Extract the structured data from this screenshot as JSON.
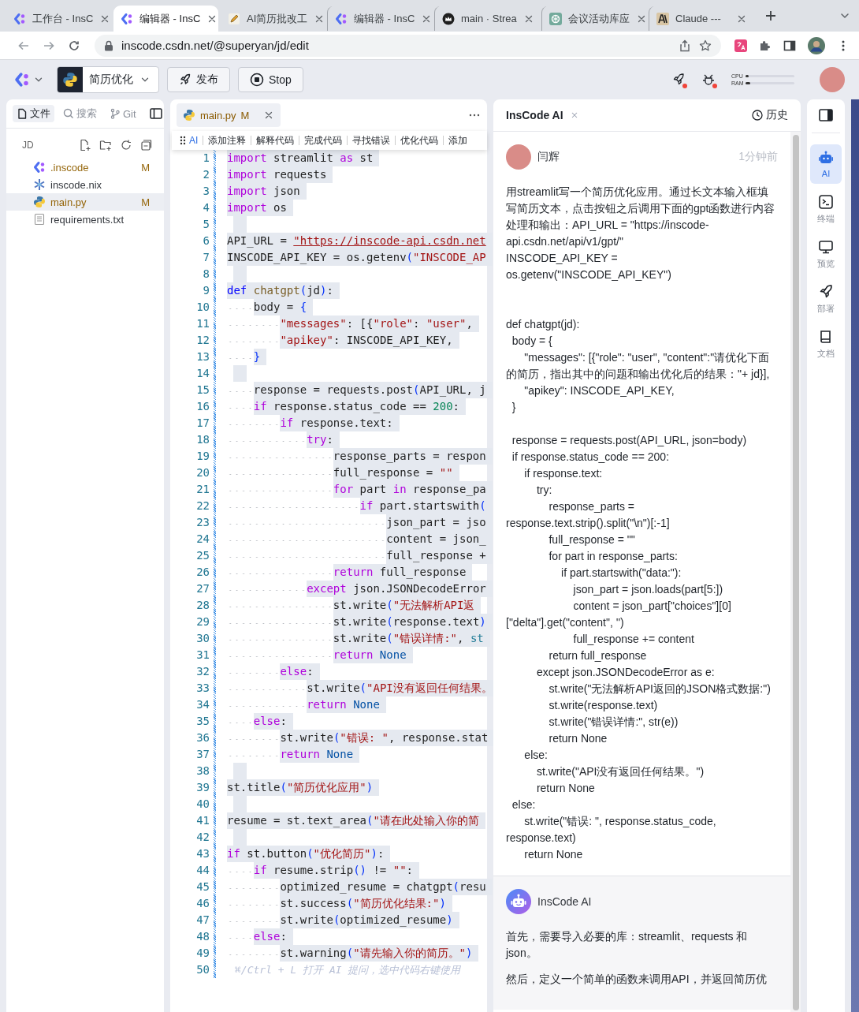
{
  "browser": {
    "tabs": [
      {
        "kind": "inscode",
        "title": "工作台 - InsC",
        "selected": false
      },
      {
        "kind": "inscode",
        "title": "编辑器 - InsC",
        "selected": true
      },
      {
        "kind": "pencil",
        "title": "AI简历批改工",
        "selected": false
      },
      {
        "kind": "inscode",
        "title": "编辑器 - InsC",
        "selected": false
      },
      {
        "kind": "crown",
        "title": "main · Strea",
        "selected": false
      },
      {
        "kind": "knot",
        "title": "会议活动库应",
        "selected": false
      },
      {
        "kind": "claude",
        "title": "Claude ---",
        "selected": false
      }
    ],
    "url": "inscode.csdn.net/@superyan/jd/edit"
  },
  "app_bar": {
    "project": "简历优化",
    "buttons": [
      {
        "kind": "publish",
        "label": "发布"
      },
      {
        "kind": "stop",
        "label": "Stop"
      }
    ],
    "meters": [
      {
        "label": "CPU",
        "level": 0.06
      },
      {
        "label": "RAM",
        "level": 0.1
      }
    ]
  },
  "sidebar": {
    "tabs": [
      {
        "kind": "files",
        "label": "文件",
        "selected": true
      },
      {
        "kind": "search",
        "label": "搜索",
        "selected": false
      },
      {
        "kind": "git",
        "label": "Git",
        "selected": false
      }
    ],
    "folder": "JD",
    "files": [
      {
        "kind": "inscode",
        "name": ".inscode",
        "status": "M",
        "selected": false
      },
      {
        "kind": "nix",
        "name": "inscode.nix",
        "selected": false
      },
      {
        "kind": "python",
        "name": "main.py",
        "status": "M",
        "selected": true
      },
      {
        "kind": "text",
        "name": "requirements.txt",
        "selected": false
      }
    ]
  },
  "editor": {
    "tab": {
      "name": "main.py",
      "status": "M"
    },
    "ai_actions": [
      "AI",
      "添加注释",
      "解释代码",
      "完成代码",
      "寻找错误",
      "优化代码",
      "添加"
    ],
    "lines": [
      {
        "number": "1",
        "selected": true,
        "tokens": [
          {
            "kind": "keyword",
            "text": "import"
          },
          {
            "text": " streamlit "
          },
          {
            "kind": "keyword",
            "text": "as"
          },
          {
            "text": " st"
          }
        ]
      },
      {
        "number": "2",
        "selected": true,
        "tokens": [
          {
            "kind": "keyword",
            "text": "import"
          },
          {
            "text": " requests"
          }
        ]
      },
      {
        "number": "3",
        "selected": true,
        "tokens": [
          {
            "kind": "keyword",
            "text": "import"
          },
          {
            "text": " json"
          }
        ]
      },
      {
        "number": "4",
        "selected": true,
        "tokens": [
          {
            "kind": "keyword",
            "text": "import"
          },
          {
            "text": " os"
          }
        ]
      },
      {
        "number": "5",
        "selected": true
      },
      {
        "number": "6",
        "selected": true,
        "tokens": [
          {
            "text": "API_URL = "
          },
          {
            "kind": "link",
            "text": "\"https://inscode-api.csdn.net"
          }
        ]
      },
      {
        "number": "7",
        "selected": true,
        "tokens": [
          {
            "text": "INSCODE_API_KEY = os.getenv"
          },
          {
            "kind": "bracket",
            "text": "("
          },
          {
            "kind": "string",
            "text": "\"INSCODE_AP"
          }
        ]
      },
      {
        "number": "8",
        "selected": true
      },
      {
        "number": "9",
        "selected": true,
        "tokens": [
          {
            "kind": "storage",
            "text": "def"
          },
          {
            "kind": "function",
            "text": " chatgpt"
          },
          {
            "kind": "bracket",
            "text": "("
          },
          {
            "text": "jd"
          },
          {
            "kind": "bracket",
            "text": ")"
          },
          {
            "text": ":"
          }
        ]
      },
      {
        "number": "10",
        "selected": true,
        "tokens": [
          {
            "text": "    body = "
          },
          {
            "kind": "bracket",
            "text": "{"
          }
        ]
      },
      {
        "number": "11",
        "selected": true,
        "tokens": [
          {
            "kind": "string",
            "text": "        \"messages\""
          },
          {
            "text": ": [{"
          },
          {
            "kind": "string",
            "text": "\"role\""
          },
          {
            "text": ": "
          },
          {
            "kind": "string",
            "text": "\"user\""
          },
          {
            "text": ","
          }
        ]
      },
      {
        "number": "12",
        "selected": true,
        "tokens": [
          {
            "kind": "string",
            "text": "        \"apikey\""
          },
          {
            "text": ": INSCODE_API_KEY,"
          }
        ]
      },
      {
        "number": "13",
        "selected": true,
        "tokens": [
          {
            "kind": "bracket",
            "text": "    }"
          }
        ]
      },
      {
        "number": "14",
        "selected": true
      },
      {
        "number": "15",
        "selected": true,
        "tokens": [
          {
            "text": "    response = requests.post"
          },
          {
            "kind": "bracket",
            "text": "("
          },
          {
            "text": "API_URL, j"
          }
        ]
      },
      {
        "number": "16",
        "selected": true,
        "tokens": [
          {
            "kind": "keyword",
            "text": "    if"
          },
          {
            "text": " response.status_code == "
          },
          {
            "kind": "number",
            "text": "200"
          },
          {
            "text": ":"
          }
        ]
      },
      {
        "number": "17",
        "selected": true,
        "tokens": [
          {
            "kind": "keyword",
            "text": "        if"
          },
          {
            "text": " response.text:"
          }
        ]
      },
      {
        "number": "18",
        "selected": true,
        "tokens": [
          {
            "kind": "keyword",
            "text": "            try"
          },
          {
            "text": ":"
          }
        ]
      },
      {
        "number": "19",
        "selected": true,
        "tokens": [
          {
            "text": "                response_parts = respon"
          }
        ]
      },
      {
        "number": "20",
        "selected": true,
        "tokens": [
          {
            "text": "                full_response = "
          },
          {
            "kind": "string",
            "text": "\"\""
          }
        ]
      },
      {
        "number": "21",
        "selected": true,
        "tokens": [
          {
            "kind": "keyword",
            "text": "                for"
          },
          {
            "text": " part "
          },
          {
            "kind": "keyword",
            "text": "in"
          },
          {
            "text": " response_pa"
          }
        ]
      },
      {
        "number": "22",
        "selected": true,
        "tokens": [
          {
            "kind": "keyword",
            "text": "                    if"
          },
          {
            "text": " part.startswith"
          },
          {
            "kind": "bracket",
            "text": "("
          }
        ]
      },
      {
        "number": "23",
        "selected": true,
        "tokens": [
          {
            "text": "                        json_part = jso"
          }
        ]
      },
      {
        "number": "24",
        "selected": true,
        "tokens": [
          {
            "text": "                        content = json_"
          }
        ]
      },
      {
        "number": "25",
        "selected": true,
        "tokens": [
          {
            "text": "                        full_response +"
          }
        ]
      },
      {
        "number": "26",
        "selected": true,
        "tokens": [
          {
            "kind": "keyword",
            "text": "                return"
          },
          {
            "text": " full_response"
          }
        ]
      },
      {
        "number": "27",
        "selected": true,
        "tokens": [
          {
            "kind": "keyword",
            "text": "            except"
          },
          {
            "text": " json.JSONDecodeError"
          }
        ]
      },
      {
        "number": "28",
        "selected": true,
        "tokens": [
          {
            "text": "                st.write"
          },
          {
            "kind": "bracket",
            "text": "("
          },
          {
            "kind": "string",
            "text": "\"无法解析API返"
          }
        ]
      },
      {
        "number": "29",
        "selected": true,
        "tokens": [
          {
            "text": "                st.write"
          },
          {
            "kind": "bracket",
            "text": "("
          },
          {
            "text": "response.text"
          },
          {
            "kind": "bracket",
            "text": ")"
          }
        ]
      },
      {
        "number": "30",
        "selected": true,
        "tokens": [
          {
            "text": "                st.write"
          },
          {
            "kind": "bracket",
            "text": "("
          },
          {
            "kind": "string",
            "text": "\"错误详情:\""
          },
          {
            "text": ", "
          },
          {
            "kind": "builtin",
            "text": "st"
          }
        ]
      },
      {
        "number": "31",
        "selected": true,
        "tokens": [
          {
            "kind": "keyword",
            "text": "                return"
          },
          {
            "kind": "constant",
            "text": " None"
          }
        ]
      },
      {
        "number": "32",
        "selected": true,
        "tokens": [
          {
            "kind": "keyword",
            "text": "        else"
          },
          {
            "text": ":"
          }
        ]
      },
      {
        "number": "33",
        "selected": true,
        "tokens": [
          {
            "text": "            st.write"
          },
          {
            "kind": "bracket",
            "text": "("
          },
          {
            "kind": "string",
            "text": "\"API没有返回任何结果。"
          }
        ]
      },
      {
        "number": "34",
        "selected": true,
        "tokens": [
          {
            "kind": "keyword",
            "text": "            return"
          },
          {
            "kind": "constant",
            "text": " None"
          }
        ]
      },
      {
        "number": "35",
        "selected": true,
        "tokens": [
          {
            "kind": "keyword",
            "text": "    else"
          },
          {
            "text": ":"
          }
        ]
      },
      {
        "number": "36",
        "selected": true,
        "tokens": [
          {
            "text": "        st.write"
          },
          {
            "kind": "bracket",
            "text": "("
          },
          {
            "kind": "string",
            "text": "\"错误: \""
          },
          {
            "text": ", response.stat"
          }
        ]
      },
      {
        "number": "37",
        "selected": true,
        "tokens": [
          {
            "kind": "keyword",
            "text": "        return"
          },
          {
            "kind": "constant",
            "text": " None"
          }
        ]
      },
      {
        "number": "38",
        "selected": true
      },
      {
        "number": "39",
        "selected": true,
        "tokens": [
          {
            "text": "st.title"
          },
          {
            "kind": "bracket",
            "text": "("
          },
          {
            "kind": "string",
            "text": "\"简历优化应用\""
          },
          {
            "kind": "bracket",
            "text": ")"
          }
        ]
      },
      {
        "number": "40",
        "selected": true
      },
      {
        "number": "41",
        "selected": true,
        "tokens": [
          {
            "text": "resume = st.text_area"
          },
          {
            "kind": "bracket",
            "text": "("
          },
          {
            "kind": "string",
            "text": "\"请在此处输入你的简"
          }
        ]
      },
      {
        "number": "42",
        "selected": true
      },
      {
        "number": "43",
        "selected": true,
        "tokens": [
          {
            "kind": "keyword",
            "text": "if"
          },
          {
            "text": " st.button"
          },
          {
            "kind": "bracket",
            "text": "("
          },
          {
            "kind": "string",
            "text": "\"优化简历\""
          },
          {
            "kind": "bracket",
            "text": ")"
          },
          {
            "text": ":"
          }
        ]
      },
      {
        "number": "44",
        "selected": true,
        "tokens": [
          {
            "kind": "keyword",
            "text": "    if"
          },
          {
            "text": " resume.strip"
          },
          {
            "kind": "bracket",
            "text": "()"
          },
          {
            "text": " != "
          },
          {
            "kind": "string",
            "text": "\"\""
          },
          {
            "text": ":"
          }
        ]
      },
      {
        "number": "45",
        "selected": true,
        "tokens": [
          {
            "text": "        optimized_resume = chatgpt"
          },
          {
            "kind": "bracket",
            "text": "("
          },
          {
            "text": "resu"
          }
        ]
      },
      {
        "number": "46",
        "selected": true,
        "tokens": [
          {
            "text": "        st.success"
          },
          {
            "kind": "bracket",
            "text": "("
          },
          {
            "kind": "string",
            "text": "\"简历优化结果:\""
          },
          {
            "kind": "bracket",
            "text": ")"
          }
        ]
      },
      {
        "number": "47",
        "selected": true,
        "tokens": [
          {
            "text": "        st.write"
          },
          {
            "kind": "bracket",
            "text": "("
          },
          {
            "text": "optimized_resume"
          },
          {
            "kind": "bracket",
            "text": ")"
          }
        ]
      },
      {
        "number": "48",
        "selected": true,
        "tokens": [
          {
            "kind": "keyword",
            "text": "    else"
          },
          {
            "text": ":"
          }
        ]
      },
      {
        "number": "49",
        "selected": true,
        "tokens": [
          {
            "text": "        st.warning"
          },
          {
            "kind": "bracket",
            "text": "("
          },
          {
            "kind": "string",
            "text": "\"请先输入你的简历。\""
          },
          {
            "kind": "bracket",
            "text": ")"
          }
        ]
      },
      {
        "number": "50",
        "selected": false,
        "hint": "⌘/Ctrl + L 打开 AI 提问，选中代码右键使用"
      }
    ]
  },
  "chat": {
    "title": "InsCode AI",
    "history": "历史",
    "messages": [
      {
        "kind": "user",
        "author": "闫辉",
        "time": "1分钟前",
        "text": "用streamlit写一个简历优化应用。通过长文本输入框填写简历文本，点击按钮之后调用下面的gpt函数进行内容处理和输出：API_URL = \"https://inscode-api.csdn.net/api/v1/gpt/\"\nINSCODE_API_KEY = os.getenv(\"INSCODE_API_KEY\")\n\n\ndef chatgpt(jd):\n  body = {\n      \"messages\": [{\"role\": \"user\", \"content\":\"请优化下面的简历，指出其中的问题和输出优化后的结果：\"+ jd}],\n      \"apikey\": INSCODE_API_KEY,\n  }\n\n  response = requests.post(API_URL, json=body)\n  if response.status_code == 200:\n      if response.text:\n          try:\n              response_parts = response.text.strip().split(\"\\n\")[:-1]\n              full_response = \"\"\n              for part in response_parts:\n                  if part.startswith(\"data:\"):\n                      json_part = json.loads(part[5:])\n                      content = json_part[\"choices\"][0][\"delta\"].get(\"content\", '')\n                      full_response += content\n              return full_response\n          except json.JSONDecodeError as e:\n              st.write(\"无法解析API返回的JSON格式数据:\")\n              st.write(response.text)\n              st.write(\"错误详情:\", str(e))\n              return None\n      else:\n          st.write(\"API没有返回任何结果。\")\n          return None\n  else:\n      st.write(\"错误: \", response.status_code, response.text)\n      return None"
      },
      {
        "kind": "ai",
        "author": "InsCode AI",
        "paragraphs": [
          "首先，需要导入必要的库：streamlit、requests 和 json。",
          "然后，定义一个简单的函数来调用API，并返回简历优"
        ]
      }
    ]
  },
  "rail": [
    {
      "kind": "ai",
      "label": "AI",
      "selected": true
    },
    {
      "kind": "terminal",
      "label": "终端",
      "selected": false
    },
    {
      "kind": "preview",
      "label": "预览",
      "selected": false
    },
    {
      "kind": "deploy",
      "label": "部署",
      "selected": false
    },
    {
      "kind": "docs",
      "label": "文档",
      "selected": false
    }
  ]
}
